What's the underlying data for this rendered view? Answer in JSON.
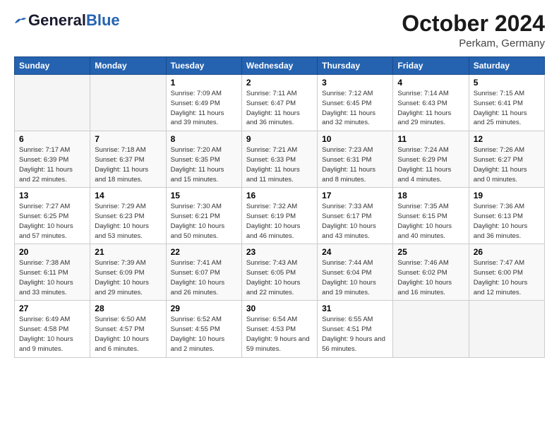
{
  "logo": {
    "line1": "General",
    "line2": "Blue"
  },
  "header": {
    "month": "October 2024",
    "location": "Perkam, Germany"
  },
  "weekdays": [
    "Sunday",
    "Monday",
    "Tuesday",
    "Wednesday",
    "Thursday",
    "Friday",
    "Saturday"
  ],
  "weeks": [
    [
      {
        "day": "",
        "sunrise": "",
        "sunset": "",
        "daylight": ""
      },
      {
        "day": "",
        "sunrise": "",
        "sunset": "",
        "daylight": ""
      },
      {
        "day": "1",
        "sunrise": "Sunrise: 7:09 AM",
        "sunset": "Sunset: 6:49 PM",
        "daylight": "Daylight: 11 hours and 39 minutes."
      },
      {
        "day": "2",
        "sunrise": "Sunrise: 7:11 AM",
        "sunset": "Sunset: 6:47 PM",
        "daylight": "Daylight: 11 hours and 36 minutes."
      },
      {
        "day": "3",
        "sunrise": "Sunrise: 7:12 AM",
        "sunset": "Sunset: 6:45 PM",
        "daylight": "Daylight: 11 hours and 32 minutes."
      },
      {
        "day": "4",
        "sunrise": "Sunrise: 7:14 AM",
        "sunset": "Sunset: 6:43 PM",
        "daylight": "Daylight: 11 hours and 29 minutes."
      },
      {
        "day": "5",
        "sunrise": "Sunrise: 7:15 AM",
        "sunset": "Sunset: 6:41 PM",
        "daylight": "Daylight: 11 hours and 25 minutes."
      }
    ],
    [
      {
        "day": "6",
        "sunrise": "Sunrise: 7:17 AM",
        "sunset": "Sunset: 6:39 PM",
        "daylight": "Daylight: 11 hours and 22 minutes."
      },
      {
        "day": "7",
        "sunrise": "Sunrise: 7:18 AM",
        "sunset": "Sunset: 6:37 PM",
        "daylight": "Daylight: 11 hours and 18 minutes."
      },
      {
        "day": "8",
        "sunrise": "Sunrise: 7:20 AM",
        "sunset": "Sunset: 6:35 PM",
        "daylight": "Daylight: 11 hours and 15 minutes."
      },
      {
        "day": "9",
        "sunrise": "Sunrise: 7:21 AM",
        "sunset": "Sunset: 6:33 PM",
        "daylight": "Daylight: 11 hours and 11 minutes."
      },
      {
        "day": "10",
        "sunrise": "Sunrise: 7:23 AM",
        "sunset": "Sunset: 6:31 PM",
        "daylight": "Daylight: 11 hours and 8 minutes."
      },
      {
        "day": "11",
        "sunrise": "Sunrise: 7:24 AM",
        "sunset": "Sunset: 6:29 PM",
        "daylight": "Daylight: 11 hours and 4 minutes."
      },
      {
        "day": "12",
        "sunrise": "Sunrise: 7:26 AM",
        "sunset": "Sunset: 6:27 PM",
        "daylight": "Daylight: 11 hours and 0 minutes."
      }
    ],
    [
      {
        "day": "13",
        "sunrise": "Sunrise: 7:27 AM",
        "sunset": "Sunset: 6:25 PM",
        "daylight": "Daylight: 10 hours and 57 minutes."
      },
      {
        "day": "14",
        "sunrise": "Sunrise: 7:29 AM",
        "sunset": "Sunset: 6:23 PM",
        "daylight": "Daylight: 10 hours and 53 minutes."
      },
      {
        "day": "15",
        "sunrise": "Sunrise: 7:30 AM",
        "sunset": "Sunset: 6:21 PM",
        "daylight": "Daylight: 10 hours and 50 minutes."
      },
      {
        "day": "16",
        "sunrise": "Sunrise: 7:32 AM",
        "sunset": "Sunset: 6:19 PM",
        "daylight": "Daylight: 10 hours and 46 minutes."
      },
      {
        "day": "17",
        "sunrise": "Sunrise: 7:33 AM",
        "sunset": "Sunset: 6:17 PM",
        "daylight": "Daylight: 10 hours and 43 minutes."
      },
      {
        "day": "18",
        "sunrise": "Sunrise: 7:35 AM",
        "sunset": "Sunset: 6:15 PM",
        "daylight": "Daylight: 10 hours and 40 minutes."
      },
      {
        "day": "19",
        "sunrise": "Sunrise: 7:36 AM",
        "sunset": "Sunset: 6:13 PM",
        "daylight": "Daylight: 10 hours and 36 minutes."
      }
    ],
    [
      {
        "day": "20",
        "sunrise": "Sunrise: 7:38 AM",
        "sunset": "Sunset: 6:11 PM",
        "daylight": "Daylight: 10 hours and 33 minutes."
      },
      {
        "day": "21",
        "sunrise": "Sunrise: 7:39 AM",
        "sunset": "Sunset: 6:09 PM",
        "daylight": "Daylight: 10 hours and 29 minutes."
      },
      {
        "day": "22",
        "sunrise": "Sunrise: 7:41 AM",
        "sunset": "Sunset: 6:07 PM",
        "daylight": "Daylight: 10 hours and 26 minutes."
      },
      {
        "day": "23",
        "sunrise": "Sunrise: 7:43 AM",
        "sunset": "Sunset: 6:05 PM",
        "daylight": "Daylight: 10 hours and 22 minutes."
      },
      {
        "day": "24",
        "sunrise": "Sunrise: 7:44 AM",
        "sunset": "Sunset: 6:04 PM",
        "daylight": "Daylight: 10 hours and 19 minutes."
      },
      {
        "day": "25",
        "sunrise": "Sunrise: 7:46 AM",
        "sunset": "Sunset: 6:02 PM",
        "daylight": "Daylight: 10 hours and 16 minutes."
      },
      {
        "day": "26",
        "sunrise": "Sunrise: 7:47 AM",
        "sunset": "Sunset: 6:00 PM",
        "daylight": "Daylight: 10 hours and 12 minutes."
      }
    ],
    [
      {
        "day": "27",
        "sunrise": "Sunrise: 6:49 AM",
        "sunset": "Sunset: 4:58 PM",
        "daylight": "Daylight: 10 hours and 9 minutes."
      },
      {
        "day": "28",
        "sunrise": "Sunrise: 6:50 AM",
        "sunset": "Sunset: 4:57 PM",
        "daylight": "Daylight: 10 hours and 6 minutes."
      },
      {
        "day": "29",
        "sunrise": "Sunrise: 6:52 AM",
        "sunset": "Sunset: 4:55 PM",
        "daylight": "Daylight: 10 hours and 2 minutes."
      },
      {
        "day": "30",
        "sunrise": "Sunrise: 6:54 AM",
        "sunset": "Sunset: 4:53 PM",
        "daylight": "Daylight: 9 hours and 59 minutes."
      },
      {
        "day": "31",
        "sunrise": "Sunrise: 6:55 AM",
        "sunset": "Sunset: 4:51 PM",
        "daylight": "Daylight: 9 hours and 56 minutes."
      },
      {
        "day": "",
        "sunrise": "",
        "sunset": "",
        "daylight": ""
      },
      {
        "day": "",
        "sunrise": "",
        "sunset": "",
        "daylight": ""
      }
    ]
  ]
}
